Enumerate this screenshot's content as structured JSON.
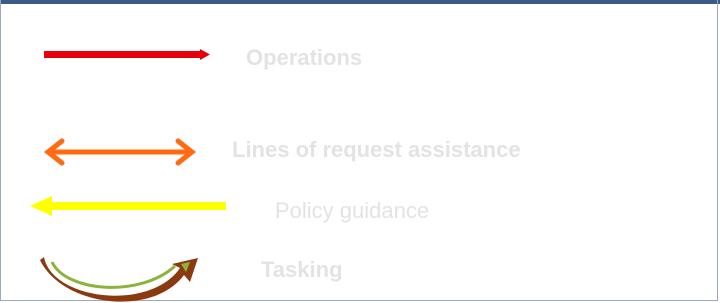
{
  "legend": {
    "items": [
      {
        "label": "Operations",
        "color": "#e8000b",
        "icon": "arrow-right"
      },
      {
        "label": "Lines of request assistance",
        "color": "#ff6a13",
        "icon": "double-arrow"
      },
      {
        "label": "Policy guidance",
        "color": "#ffff00",
        "icon": "arrow-left"
      },
      {
        "label": "Tasking",
        "colors": [
          "#8b3a0f",
          "#8db33b"
        ],
        "icon": "curved-arrow"
      }
    ]
  }
}
